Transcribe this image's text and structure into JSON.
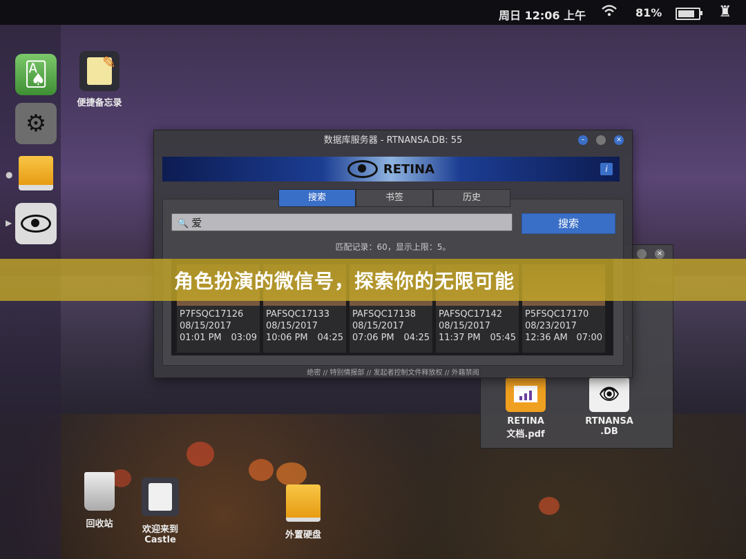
{
  "topbar": {
    "clock": "周日 12:06 上午",
    "battery_pct": "81%",
    "battery_level": 0.81,
    "icons": [
      "wifi-icon",
      "battery-icon",
      "castle-icon"
    ]
  },
  "dock": {
    "items": [
      "cards-app-icon",
      "settings-gear-icon",
      "drive-icon",
      "retina-eye-icon"
    ]
  },
  "desktop": {
    "notes_label": "便捷备忘录",
    "trash_label": "回收站",
    "welcome_label_1": "欢迎来到",
    "welcome_label_2": "Castle",
    "ext_drive_label": "外置硬盘"
  },
  "window": {
    "title": "数据库服务器 - RTNANSA.DB: 55",
    "banner_brand": "RETINA",
    "info_label": "i",
    "tabs": [
      "搜索",
      "书签",
      "历史"
    ],
    "search_value": "爱",
    "search_button": "搜索",
    "match_text": "匹配记录：60，显示上限：5。",
    "footer": "绝密 // 特别情报部 // 发起者控制文件释放权 // 外籍禁阅",
    "results": [
      {
        "id": "P7FSQC17126",
        "date": "08/15/2017",
        "time": "01:01 PM",
        "duration": "03:09"
      },
      {
        "id": "PAFSQC17133",
        "date": "08/15/2017",
        "time": "10:06 PM",
        "duration": "04:25"
      },
      {
        "id": "PAFSQC17138",
        "date": "08/15/2017",
        "time": "07:06 PM",
        "duration": "04:25"
      },
      {
        "id": "PAFSQC17142",
        "date": "08/15/2017",
        "time": "11:37 PM",
        "duration": "05:45"
      },
      {
        "id": "P5FSQC17170",
        "date": "08/23/2017",
        "time": "12:36 AM",
        "duration": "07:00"
      }
    ]
  },
  "window2": {
    "trail_text": "t",
    "files": [
      {
        "line1": "RETINA",
        "line2": "文档.pdf"
      },
      {
        "line1": "RTNANSA",
        "line2": ".DB"
      }
    ]
  },
  "headline": "角色扮演的微信号，探索你的无限可能",
  "colors": {
    "accent": "#3a6fc8",
    "overlay": "#c8aa28"
  }
}
